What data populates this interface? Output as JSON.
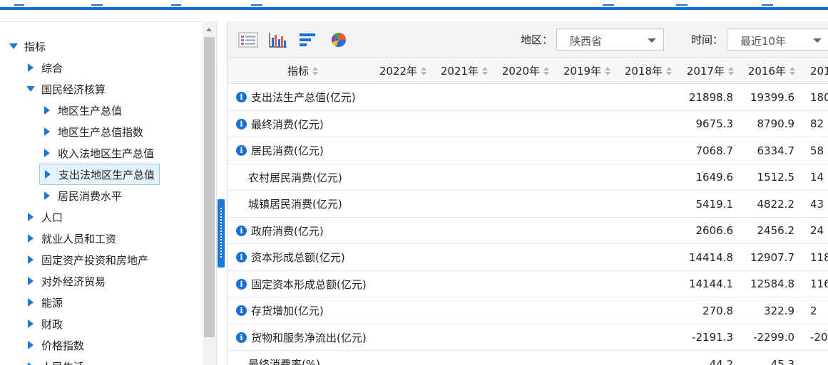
{
  "tree": {
    "root_label": "指标",
    "items": [
      {
        "label": "综合",
        "level": 1,
        "state": "collapsed",
        "selected": false
      },
      {
        "label": "国民经济核算",
        "level": 1,
        "state": "expanded",
        "selected": false
      },
      {
        "label": "地区生产总值",
        "level": 2,
        "state": "collapsed",
        "selected": false
      },
      {
        "label": "地区生产总值指数",
        "level": 2,
        "state": "collapsed",
        "selected": false
      },
      {
        "label": "收入法地区生产总值",
        "level": 2,
        "state": "collapsed",
        "selected": false
      },
      {
        "label": "支出法地区生产总值",
        "level": 2,
        "state": "collapsed",
        "selected": true
      },
      {
        "label": "居民消费水平",
        "level": 2,
        "state": "collapsed",
        "selected": false
      },
      {
        "label": "人口",
        "level": 1,
        "state": "collapsed",
        "selected": false
      },
      {
        "label": "就业人员和工资",
        "level": 1,
        "state": "collapsed",
        "selected": false
      },
      {
        "label": "固定资产投资和房地产",
        "level": 1,
        "state": "collapsed",
        "selected": false
      },
      {
        "label": "对外经济贸易",
        "level": 1,
        "state": "collapsed",
        "selected": false
      },
      {
        "label": "能源",
        "level": 1,
        "state": "collapsed",
        "selected": false
      },
      {
        "label": "财政",
        "level": 1,
        "state": "collapsed",
        "selected": false
      },
      {
        "label": "价格指数",
        "level": 1,
        "state": "collapsed",
        "selected": false
      },
      {
        "label": "人民生活",
        "level": 1,
        "state": "collapsed",
        "selected": false
      }
    ]
  },
  "toolbar": {
    "icons": [
      "table-view-icon",
      "bar-chart-icon",
      "horizontal-bar-icon",
      "pie-chart-icon"
    ],
    "region_label": "地区：",
    "region_value": "陕西省",
    "time_label": "时间：",
    "time_value": "最近10年"
  },
  "table": {
    "columns": [
      "指标",
      "2022年",
      "2021年",
      "2020年",
      "2019年",
      "2018年",
      "2017年",
      "2016年",
      "201"
    ],
    "rows": [
      {
        "name": "支出法生产总值(亿元)",
        "info": true,
        "indent": false,
        "v2017": "21898.8",
        "v2016": "19399.6",
        "v2015": "180"
      },
      {
        "name": "最终消费(亿元)",
        "info": true,
        "indent": false,
        "v2017": "9675.3",
        "v2016": "8790.9",
        "v2015": "82"
      },
      {
        "name": "居民消费(亿元)",
        "info": true,
        "indent": false,
        "v2017": "7068.7",
        "v2016": "6334.7",
        "v2015": "58"
      },
      {
        "name": "农村居民消费(亿元)",
        "info": false,
        "indent": true,
        "v2017": "1649.6",
        "v2016": "1512.5",
        "v2015": "14"
      },
      {
        "name": "城镇居民消费(亿元)",
        "info": false,
        "indent": true,
        "v2017": "5419.1",
        "v2016": "4822.2",
        "v2015": "43"
      },
      {
        "name": "政府消费(亿元)",
        "info": true,
        "indent": false,
        "v2017": "2606.6",
        "v2016": "2456.2",
        "v2015": "24"
      },
      {
        "name": "资本形成总额(亿元)",
        "info": true,
        "indent": false,
        "v2017": "14414.8",
        "v2016": "12907.7",
        "v2015": "118"
      },
      {
        "name": "固定资本形成总额(亿元)",
        "info": true,
        "indent": false,
        "v2017": "14144.1",
        "v2016": "12584.8",
        "v2015": "116"
      },
      {
        "name": "存货增加(亿元)",
        "info": true,
        "indent": false,
        "v2017": "270.8",
        "v2016": "322.9",
        "v2015": "2"
      },
      {
        "name": "货物和服务净流出(亿元)",
        "info": true,
        "indent": false,
        "v2017": "-2191.3",
        "v2016": "-2299.0",
        "v2015": "-20"
      },
      {
        "name": "最终消费率(%)",
        "info": false,
        "indent": true,
        "v2017": "44.2",
        "v2016": "45.3",
        "v2015": ""
      }
    ]
  },
  "colors": {
    "accent": "#1a78d6",
    "header_bg": "#f7f7f7",
    "toolbar_bg": "#f4f4f4"
  }
}
